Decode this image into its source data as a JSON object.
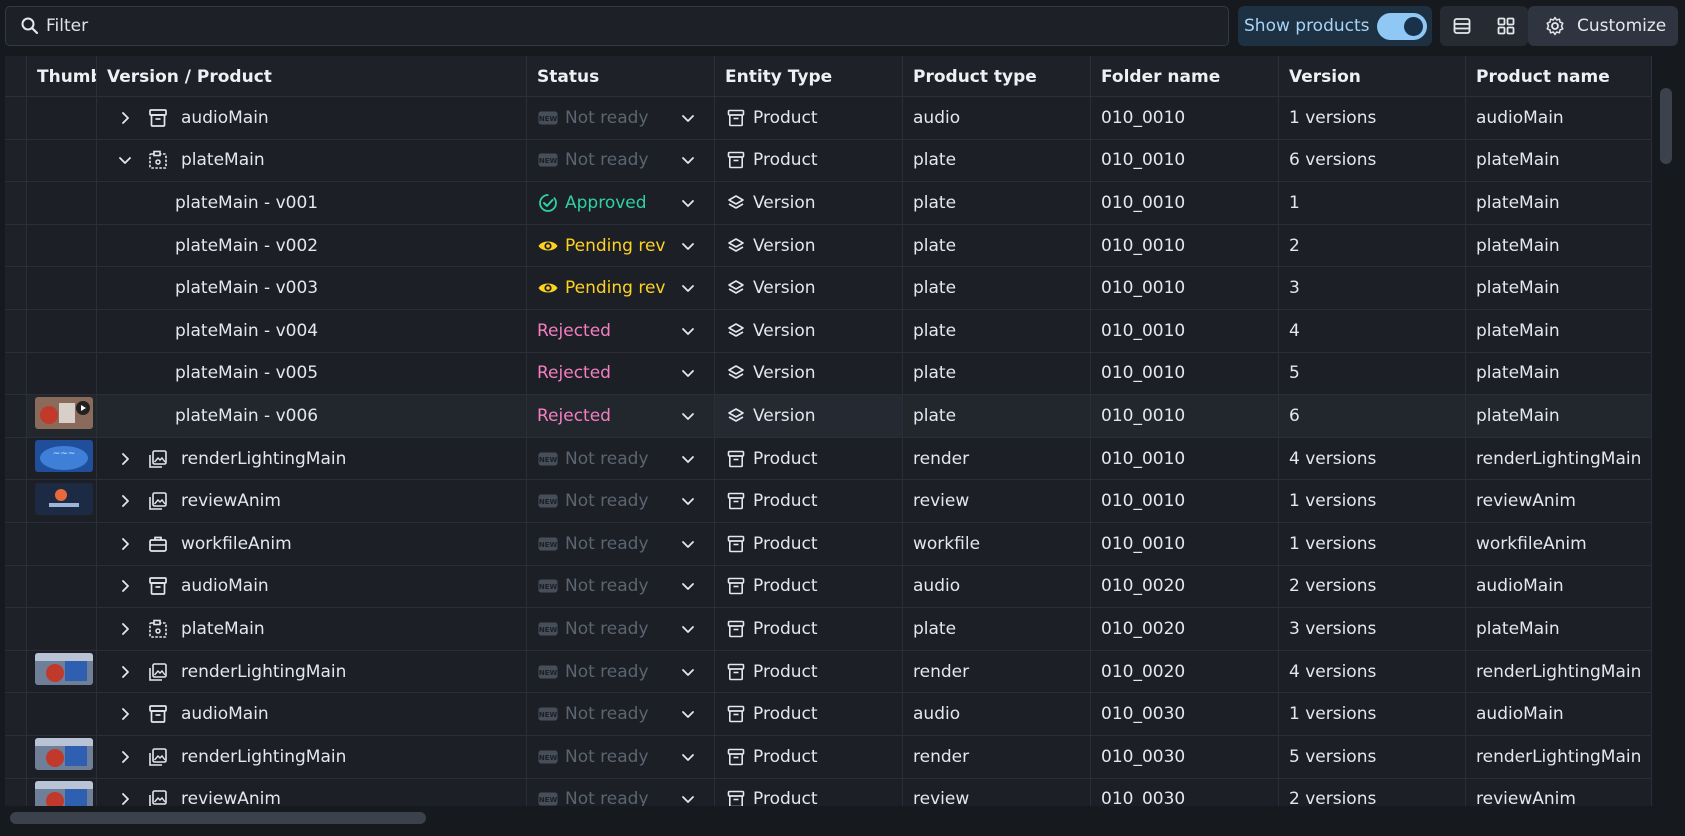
{
  "toolbar": {
    "filter_placeholder": "Filter",
    "show_products_label": "Show products",
    "show_products_on": true,
    "customize_label": "Customize"
  },
  "table": {
    "columns": [
      "Thumb",
      "Version / Product",
      "Status",
      "Entity Type",
      "Product type",
      "Folder name",
      "Version",
      "Product name"
    ],
    "rows": [
      {
        "kind": "product",
        "expand": "collapsed",
        "icon": "archive-icon",
        "name": "audioMain",
        "status": "Not ready",
        "status_kind": "notready",
        "entity": "Product",
        "ptype": "audio",
        "folder": "010_0010",
        "version": "1 versions",
        "pname": "audioMain",
        "thumb": ""
      },
      {
        "kind": "product",
        "expand": "expanded",
        "icon": "plate-icon",
        "name": "plateMain",
        "status": "Not ready",
        "status_kind": "notready",
        "entity": "Product",
        "ptype": "plate",
        "folder": "010_0010",
        "version": "6 versions",
        "pname": "plateMain",
        "thumb": ""
      },
      {
        "kind": "version",
        "name": "plateMain - v001",
        "status": "Approved",
        "status_kind": "approved",
        "entity": "Version",
        "ptype": "plate",
        "folder": "010_0010",
        "version": "1",
        "pname": "plateMain",
        "thumb": ""
      },
      {
        "kind": "version",
        "name": "plateMain - v002",
        "status": "Pending review",
        "status_kind": "pending",
        "entity": "Version",
        "ptype": "plate",
        "folder": "010_0010",
        "version": "2",
        "pname": "plateMain",
        "thumb": ""
      },
      {
        "kind": "version",
        "name": "plateMain - v003",
        "status": "Pending review",
        "status_kind": "pending",
        "entity": "Version",
        "ptype": "plate",
        "folder": "010_0010",
        "version": "3",
        "pname": "plateMain",
        "thumb": ""
      },
      {
        "kind": "version",
        "name": "plateMain - v004",
        "status": "Rejected",
        "status_kind": "rejected",
        "entity": "Version",
        "ptype": "plate",
        "folder": "010_0010",
        "version": "4",
        "pname": "plateMain",
        "thumb": ""
      },
      {
        "kind": "version",
        "name": "plateMain - v005",
        "status": "Rejected",
        "status_kind": "rejected",
        "entity": "Version",
        "ptype": "plate",
        "folder": "010_0010",
        "version": "5",
        "pname": "plateMain",
        "thumb": ""
      },
      {
        "kind": "version",
        "name": "plateMain - v006",
        "status": "Rejected",
        "status_kind": "rejected",
        "entity": "Version",
        "ptype": "plate",
        "folder": "010_0010",
        "version": "6",
        "pname": "plateMain",
        "thumb": "video",
        "selected": true
      },
      {
        "kind": "product",
        "expand": "collapsed",
        "icon": "image-icon",
        "name": "renderLightingMain",
        "status": "Not ready",
        "status_kind": "notready",
        "entity": "Product",
        "ptype": "render",
        "folder": "010_0010",
        "version": "4 versions",
        "pname": "renderLightingMain",
        "thumb": "blue"
      },
      {
        "kind": "product",
        "expand": "collapsed",
        "icon": "image-icon",
        "name": "reviewAnim",
        "status": "Not ready",
        "status_kind": "notready",
        "entity": "Product",
        "ptype": "review",
        "folder": "010_0010",
        "version": "1 versions",
        "pname": "reviewAnim",
        "thumb": "dark"
      },
      {
        "kind": "product",
        "expand": "collapsed",
        "icon": "briefcase-icon",
        "name": "workfileAnim",
        "status": "Not ready",
        "status_kind": "notready",
        "entity": "Product",
        "ptype": "workfile",
        "folder": "010_0010",
        "version": "1 versions",
        "pname": "workfileAnim",
        "thumb": ""
      },
      {
        "kind": "product",
        "expand": "collapsed",
        "icon": "archive-icon",
        "name": "audioMain",
        "status": "Not ready",
        "status_kind": "notready",
        "entity": "Product",
        "ptype": "audio",
        "folder": "010_0020",
        "version": "2 versions",
        "pname": "audioMain",
        "thumb": ""
      },
      {
        "kind": "product",
        "expand": "collapsed",
        "icon": "plate-icon",
        "name": "plateMain",
        "status": "Not ready",
        "status_kind": "notready",
        "entity": "Product",
        "ptype": "plate",
        "folder": "010_0020",
        "version": "3 versions",
        "pname": "plateMain",
        "thumb": ""
      },
      {
        "kind": "product",
        "expand": "collapsed",
        "icon": "image-icon",
        "name": "renderLightingMain",
        "status": "Not ready",
        "status_kind": "notready",
        "entity": "Product",
        "ptype": "render",
        "folder": "010_0020",
        "version": "4 versions",
        "pname": "renderLightingMain",
        "thumb": "mixed"
      },
      {
        "kind": "product",
        "expand": "collapsed",
        "icon": "archive-icon",
        "name": "audioMain",
        "status": "Not ready",
        "status_kind": "notready",
        "entity": "Product",
        "ptype": "audio",
        "folder": "010_0030",
        "version": "1 versions",
        "pname": "audioMain",
        "thumb": ""
      },
      {
        "kind": "product",
        "expand": "collapsed",
        "icon": "image-icon",
        "name": "renderLightingMain",
        "status": "Not ready",
        "status_kind": "notready",
        "entity": "Product",
        "ptype": "render",
        "folder": "010_0030",
        "version": "5 versions",
        "pname": "renderLightingMain",
        "thumb": "mixed"
      },
      {
        "kind": "product",
        "expand": "collapsed",
        "icon": "image-icon",
        "name": "reviewAnim",
        "status": "Not ready",
        "status_kind": "notready",
        "entity": "Product",
        "ptype": "review",
        "folder": "010_0030",
        "version": "2 versions",
        "pname": "reviewAnim",
        "thumb": "mixed"
      }
    ]
  }
}
